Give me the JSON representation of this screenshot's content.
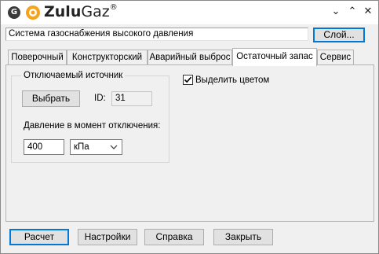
{
  "titlebar": {
    "app_icon_letter": "G",
    "brand_bold": "Zulu",
    "brand_light": "Gaz",
    "brand_mark": "®",
    "controls": {
      "collapse": "⌄",
      "expand": "⌃",
      "close": "✕"
    }
  },
  "system": {
    "name": "Система газоснабжения высокого давления",
    "layer_button": "Слой..."
  },
  "tabs": [
    {
      "label": "Поверочный",
      "active": false
    },
    {
      "label": "Конструкторский",
      "active": false
    },
    {
      "label": "Аварийный выброс",
      "active": false
    },
    {
      "label": "Остаточный запас",
      "active": true
    },
    {
      "label": "Сервис",
      "active": false
    }
  ],
  "source_group": {
    "title": "Отключаемый источник",
    "select_button": "Выбрать",
    "id_label": "ID:",
    "id_value": "31",
    "pressure_label": "Давление в момент отключения:",
    "pressure_value": "400",
    "unit_selected": "кПа"
  },
  "highlight": {
    "label": "Выделить цветом",
    "checked": true
  },
  "footer": {
    "calc": "Расчет",
    "settings": "Настройки",
    "help": "Справка",
    "close": "Закрыть"
  },
  "colors": {
    "focus_border": "#0078d7",
    "logo_orange": "#f7a21b"
  }
}
